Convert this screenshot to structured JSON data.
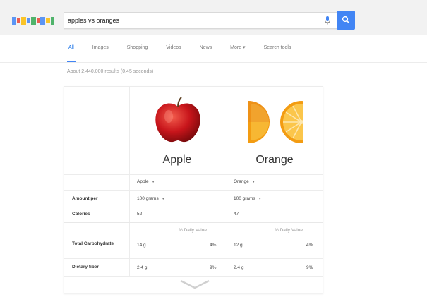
{
  "search": {
    "query": "apples vs oranges"
  },
  "logo_colors": [
    "#4285f4",
    "#ea4335",
    "#fbbc05",
    "#4285f4",
    "#34a853",
    "#ea4335",
    "#4285f4",
    "#fbbc05",
    "#34a853"
  ],
  "accent_color": "#4285f4",
  "tabs": [
    {
      "label": "All"
    },
    {
      "label": "Images"
    },
    {
      "label": "Shopping"
    },
    {
      "label": "Videos"
    },
    {
      "label": "News"
    },
    {
      "label": "More ▾"
    },
    {
      "label": "Search tools"
    }
  ],
  "result_stats": "About 2,440,000 results (0.45 seconds)",
  "comparison": {
    "fruits": [
      {
        "name": "Apple",
        "selector": "Apple",
        "amount": "100 grams",
        "calories": "52"
      },
      {
        "name": "Orange",
        "selector": "Orange",
        "amount": "100 grams",
        "calories": "47"
      }
    ],
    "row_labels": {
      "amount": "Amount per",
      "calories": "Calories"
    },
    "daily_value_header": "% Daily Value",
    "nutrients": [
      {
        "label": "Total Carbohydrate",
        "apple_amount": "14 g",
        "apple_dv": "4%",
        "orange_amount": "12 g",
        "orange_dv": "4%"
      },
      {
        "label": "Dietary fiber",
        "apple_amount": "2.4 g",
        "apple_dv": "9%",
        "orange_amount": "2.4 g",
        "orange_dv": "9%"
      }
    ]
  },
  "icons": {
    "mic": "microphone-icon",
    "search": "magnifier-icon",
    "expand": "chevron-down-icon",
    "dropdown": "caret-down-icon"
  }
}
